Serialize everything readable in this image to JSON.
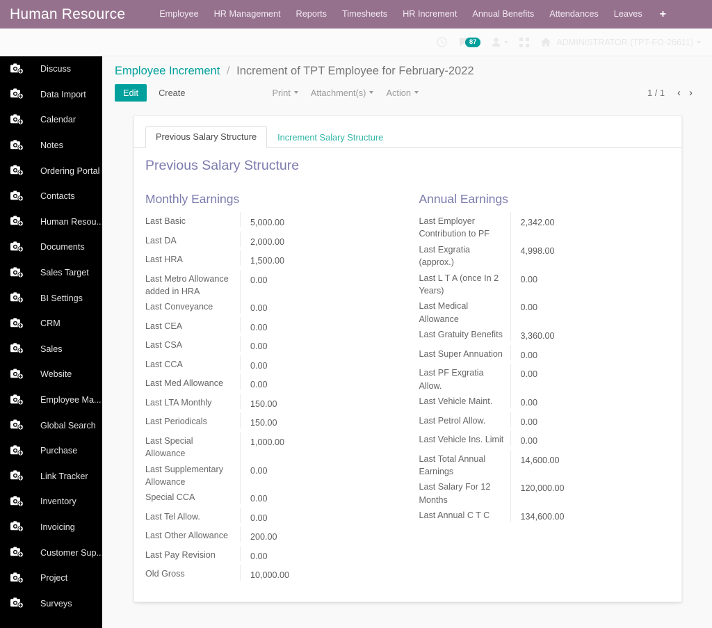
{
  "topbar": {
    "brand": "Human Resource",
    "menu": [
      "Employee",
      "HR Management",
      "Reports",
      "Timesheets",
      "HR Increment",
      "Annual Benefits",
      "Attendances",
      "Leaves"
    ],
    "plus_label": "+"
  },
  "systray": {
    "clock_icon": "clock-icon",
    "messages_icon": "chat-icon",
    "message_count": "87",
    "user_icon": "user-icon",
    "apps_icon": "grid-icon",
    "home_icon": "home-icon",
    "user_name": "ADMINISTRATOR (TPT-FO-26611)"
  },
  "sidebar": {
    "items": [
      {
        "label": "Discuss",
        "icon": "image-placeholder-icon"
      },
      {
        "label": "Data Import",
        "icon": "image-placeholder-icon"
      },
      {
        "label": "Calendar",
        "icon": "image-placeholder-icon"
      },
      {
        "label": "Notes",
        "icon": "image-placeholder-icon"
      },
      {
        "label": "Ordering Portal",
        "icon": "image-placeholder-icon"
      },
      {
        "label": "Contacts",
        "icon": "image-placeholder-icon"
      },
      {
        "label": "Human Resou...",
        "icon": "image-placeholder-icon"
      },
      {
        "label": "Documents",
        "icon": "image-placeholder-icon"
      },
      {
        "label": "Sales Target",
        "icon": "image-placeholder-icon"
      },
      {
        "label": "BI Settings",
        "icon": "image-placeholder-icon"
      },
      {
        "label": "CRM",
        "icon": "image-placeholder-icon"
      },
      {
        "label": "Sales",
        "icon": "image-placeholder-icon"
      },
      {
        "label": "Website",
        "icon": "image-placeholder-icon"
      },
      {
        "label": "Employee Ma...",
        "icon": "image-placeholder-icon"
      },
      {
        "label": "Global Search",
        "icon": "image-placeholder-icon"
      },
      {
        "label": "Purchase",
        "icon": "image-placeholder-icon"
      },
      {
        "label": "Link Tracker",
        "icon": "image-placeholder-icon"
      },
      {
        "label": "Inventory",
        "icon": "image-placeholder-icon"
      },
      {
        "label": "Invoicing",
        "icon": "image-placeholder-icon"
      },
      {
        "label": "Customer Sup...",
        "icon": "image-placeholder-icon"
      },
      {
        "label": "Project",
        "icon": "image-placeholder-icon"
      },
      {
        "label": "Surveys",
        "icon": "image-placeholder-icon"
      }
    ]
  },
  "breadcrumb": {
    "root": "Employee Increment",
    "separator": "/",
    "leaf": "Increment of TPT Employee for February-2022"
  },
  "toolbar": {
    "edit_label": "Edit",
    "create_label": "Create",
    "print_label": "Print",
    "attachments_label": "Attachment(s)",
    "action_label": "Action",
    "pager": "1 / 1",
    "prev_arrow": "‹",
    "next_arrow": "›"
  },
  "tabs": [
    {
      "label": "Previous Salary Structure",
      "active": true
    },
    {
      "label": "Increment Salary Structure",
      "active": false
    }
  ],
  "form": {
    "section_title": "Previous Salary Structure",
    "monthly": {
      "heading": "Monthly Earnings",
      "rows": [
        {
          "label": "Last Basic",
          "value": "5,000.00"
        },
        {
          "label": "Last DA",
          "value": "2,000.00"
        },
        {
          "label": "Last HRA",
          "value": "1,500.00"
        },
        {
          "label": "Last Metro Allowance added in HRA",
          "value": "0.00"
        },
        {
          "label": "Last Conveyance",
          "value": "0.00"
        },
        {
          "label": "Last CEA",
          "value": "0.00"
        },
        {
          "label": "Last CSA",
          "value": "0.00"
        },
        {
          "label": "Last CCA",
          "value": "0.00"
        },
        {
          "label": "Last Med Allowance",
          "value": "0.00"
        },
        {
          "label": "Last LTA Monthly",
          "value": "150.00"
        },
        {
          "label": "Last Periodicals",
          "value": "150.00"
        },
        {
          "label": "Last Special Allowance",
          "value": "1,000.00"
        },
        {
          "label": "Last Supplementary Allowance",
          "value": "0.00"
        },
        {
          "label": "Special CCA",
          "value": "0.00"
        },
        {
          "label": "Last Tel Allow.",
          "value": "0.00"
        },
        {
          "label": "Last Other Allowance",
          "value": "200.00"
        },
        {
          "label": "Last Pay Revision",
          "value": "0.00"
        },
        {
          "label": "Old Gross",
          "value": "10,000.00"
        }
      ]
    },
    "annual": {
      "heading": "Annual Earnings",
      "rows": [
        {
          "label": "Last Employer Contribution to PF",
          "value": "2,342.00"
        },
        {
          "label": "Last Exgratia (approx.)",
          "value": "4,998.00"
        },
        {
          "label": "Last L T A (once In 2 Years)",
          "value": "0.00"
        },
        {
          "label": "Last Medical Allowance",
          "value": "0.00"
        },
        {
          "label": "Last Gratuity Benefits",
          "value": "3,360.00"
        },
        {
          "label": "Last Super Annuation",
          "value": "0.00"
        },
        {
          "label": "Last PF Exgratia Allow.",
          "value": "0.00"
        },
        {
          "label": "Last Vehicle Maint.",
          "value": "0.00"
        },
        {
          "label": "Last Petrol Allow.",
          "value": "0.00"
        },
        {
          "label": "Last Vehicle Ins. Limit",
          "value": "0.00"
        },
        {
          "label": "Last Total Annual Earnings",
          "value": "14,600.00"
        },
        {
          "label": "Last Salary For 12 Months",
          "value": "120,000.00"
        },
        {
          "label": "Last Annual C T C",
          "value": "134,600.00"
        }
      ]
    }
  },
  "colors": {
    "header_purple": "#96718e",
    "accent_teal": "#00a09d",
    "section_heading": "#7c7bad",
    "sidebar_bg": "#000000",
    "page_bg": "#f9f9f9"
  }
}
